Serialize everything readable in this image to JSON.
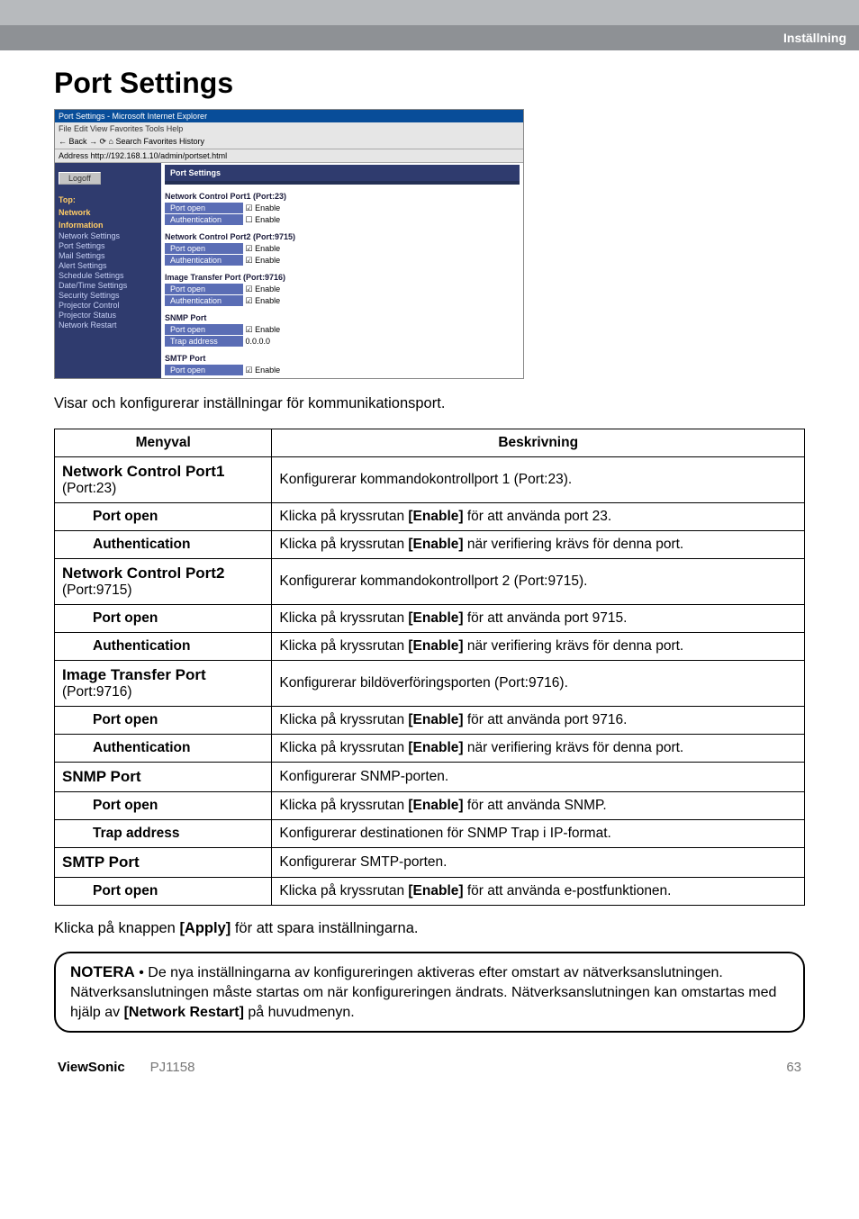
{
  "header": {
    "section": "Inställning"
  },
  "page": {
    "title": "Port Settings",
    "intro": "Visar och konfigurerar inställningar för kommunikationsport.",
    "conclusion_pre": "Klicka på knappen ",
    "conclusion_btn": "[Apply]",
    "conclusion_post": " för att spara inställningarna."
  },
  "screenshot": {
    "titlebar": "Port Settings - Microsoft Internet Explorer",
    "menubar": "File   Edit   View   Favorites   Tools   Help",
    "toolbar": "← Back  →  ⟳  ⌂  Search  Favorites  History",
    "addrbar": "Address  http://192.168.1.10/admin/portset.html",
    "nav_logoff": "Logoff",
    "nav_top1": "Top:",
    "nav_top2": "Network",
    "nav_top3": "Information",
    "nav_items": [
      "Network Settings",
      "Port Settings",
      "Mail Settings",
      "Alert Settings",
      "Schedule Settings",
      "Date/Time Settings",
      "Security Settings",
      "Projector Control",
      "Projector Status",
      "Network Restart"
    ],
    "panel_title": "Port Settings",
    "groups": [
      {
        "g": "Network Control Port1 (Port:23)",
        "rows": [
          [
            "Port open",
            "☑ Enable"
          ],
          [
            "Authentication",
            "☐ Enable"
          ]
        ]
      },
      {
        "g": "Network Control Port2 (Port:9715)",
        "rows": [
          [
            "Port open",
            "☑ Enable"
          ],
          [
            "Authentication",
            "☑ Enable"
          ]
        ]
      },
      {
        "g": "Image Transfer Port (Port:9716)",
        "rows": [
          [
            "Port open",
            "☑ Enable"
          ],
          [
            "Authentication",
            "☑ Enable"
          ]
        ]
      },
      {
        "g": "SNMP Port",
        "rows": [
          [
            "Port open",
            "☑ Enable"
          ],
          [
            "Trap address",
            "0.0.0.0"
          ]
        ]
      },
      {
        "g": "SMTP Port",
        "rows": [
          [
            "Port open",
            "☑ Enable"
          ]
        ]
      }
    ]
  },
  "table": {
    "head_menu": "Menyval",
    "head_desc": "Beskrivning",
    "rows": [
      {
        "type": "section",
        "label_a": "Network Control Port1",
        "label_b": "(Port:23)",
        "desc": "Konfigurerar kommandokontrollport 1 (Port:23)."
      },
      {
        "type": "sub",
        "label": "Port open",
        "desc_pre": "Klicka på kryssrutan ",
        "desc_b": "[Enable]",
        "desc_post": " för att använda port 23."
      },
      {
        "type": "sub",
        "label": "Authentication",
        "desc_pre": "Klicka på kryssrutan ",
        "desc_b": "[Enable]",
        "desc_post": " när verifiering krävs för denna port."
      },
      {
        "type": "section",
        "label_a": "Network Control Port2",
        "label_b": "(Port:9715)",
        "desc": "Konfigurerar kommandokontrollport 2 (Port:9715)."
      },
      {
        "type": "sub",
        "label": "Port open",
        "desc_pre": "Klicka på kryssrutan ",
        "desc_b": "[Enable]",
        "desc_post": " för att använda port 9715."
      },
      {
        "type": "sub",
        "label": "Authentication",
        "desc_pre": "Klicka på kryssrutan ",
        "desc_b": "[Enable]",
        "desc_post": " när verifiering krävs för denna port."
      },
      {
        "type": "section",
        "label_a": "Image Transfer Port",
        "label_b": "(Port:9716)",
        "desc": "Konfigurerar bildöverföringsporten (Port:9716)."
      },
      {
        "type": "sub",
        "label": "Port open",
        "desc_pre": "Klicka på kryssrutan ",
        "desc_b": "[Enable]",
        "desc_post": " för att använda port 9716."
      },
      {
        "type": "sub",
        "label": "Authentication",
        "desc_pre": "Klicka på kryssrutan ",
        "desc_b": "[Enable]",
        "desc_post": " när verifiering krävs för denna port."
      },
      {
        "type": "section",
        "label_a": "SNMP Port",
        "label_b": "",
        "desc": "Konfigurerar SNMP-porten."
      },
      {
        "type": "sub",
        "label": "Port open",
        "desc_pre": "Klicka på kryssrutan ",
        "desc_b": "[Enable]",
        "desc_post": " för att använda SNMP."
      },
      {
        "type": "sub",
        "label": "Trap address",
        "desc_pre": "Konfigurerar destinationen för SNMP Trap i IP-format.",
        "desc_b": "",
        "desc_post": ""
      },
      {
        "type": "section",
        "label_a": "SMTP Port",
        "label_b": "",
        "desc": "Konfigurerar SMTP-porten."
      },
      {
        "type": "sub",
        "label": "Port open",
        "desc_pre": "Klicka på kryssrutan ",
        "desc_b": "[Enable]",
        "desc_post": " för att använda e-postfunktionen."
      }
    ]
  },
  "note": {
    "prefix": "NOTERA",
    "body_pre": " • De nya inställningarna av konfigureringen aktiveras efter omstart av nätverksanslutningen. Nätverksanslutningen måste startas om när konfigureringen ändrats. Nätverksanslutningen kan omstartas med hjälp av ",
    "body_b": "[Network Restart]",
    "body_post": " på huvudmenyn."
  },
  "footer": {
    "brand": "ViewSonic",
    "model": "PJ1158",
    "page": "63"
  }
}
